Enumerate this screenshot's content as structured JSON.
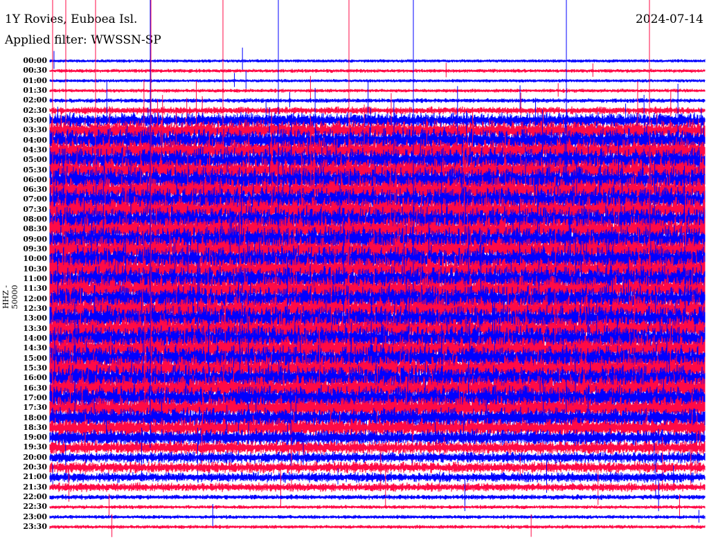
{
  "header": {
    "station": "1Y Rovies, Euboea Isl.",
    "filter": "Applied filter: WWSSN-SP",
    "date": "2024-07-14"
  },
  "chart_data": {
    "type": "line",
    "title": "1Y Rovies, Euboea Isl.",
    "ylabel": "HHZ - 50000",
    "xlabel": "",
    "series_colors": [
      "#0000ff",
      "#ff0a46"
    ],
    "row_labels": [
      "00:00",
      "00:30",
      "01:00",
      "01:30",
      "02:00",
      "02:30",
      "03:00",
      "03:30",
      "04:00",
      "04:30",
      "05:00",
      "05:30",
      "06:00",
      "06:30",
      "07:00",
      "07:30",
      "08:00",
      "08:30",
      "09:00",
      "09:30",
      "10:00",
      "10:30",
      "11:00",
      "11:30",
      "12:00",
      "12:30",
      "13:00",
      "13:30",
      "14:00",
      "14:30",
      "15:00",
      "15:30",
      "16:00",
      "16:30",
      "17:00",
      "17:30",
      "18:00",
      "18:30",
      "19:00",
      "19:30",
      "20:00",
      "20:30",
      "21:00",
      "21:30",
      "22:00",
      "22:30",
      "23:00",
      "23:30"
    ],
    "relative_amplitude": [
      0.25,
      0.3,
      0.25,
      0.3,
      0.35,
      0.6,
      1.2,
      1.6,
      1.8,
      1.8,
      1.9,
      1.9,
      2.0,
      2.0,
      2.0,
      2.0,
      2.0,
      2.0,
      2.0,
      2.0,
      2.0,
      2.0,
      2.0,
      2.0,
      2.0,
      2.0,
      2.0,
      2.0,
      2.0,
      2.0,
      2.0,
      2.0,
      2.0,
      2.0,
      1.9,
      1.8,
      1.6,
      1.5,
      1.3,
      1.1,
      0.9,
      0.9,
      0.8,
      0.7,
      0.4,
      0.3,
      0.3,
      0.3
    ]
  }
}
